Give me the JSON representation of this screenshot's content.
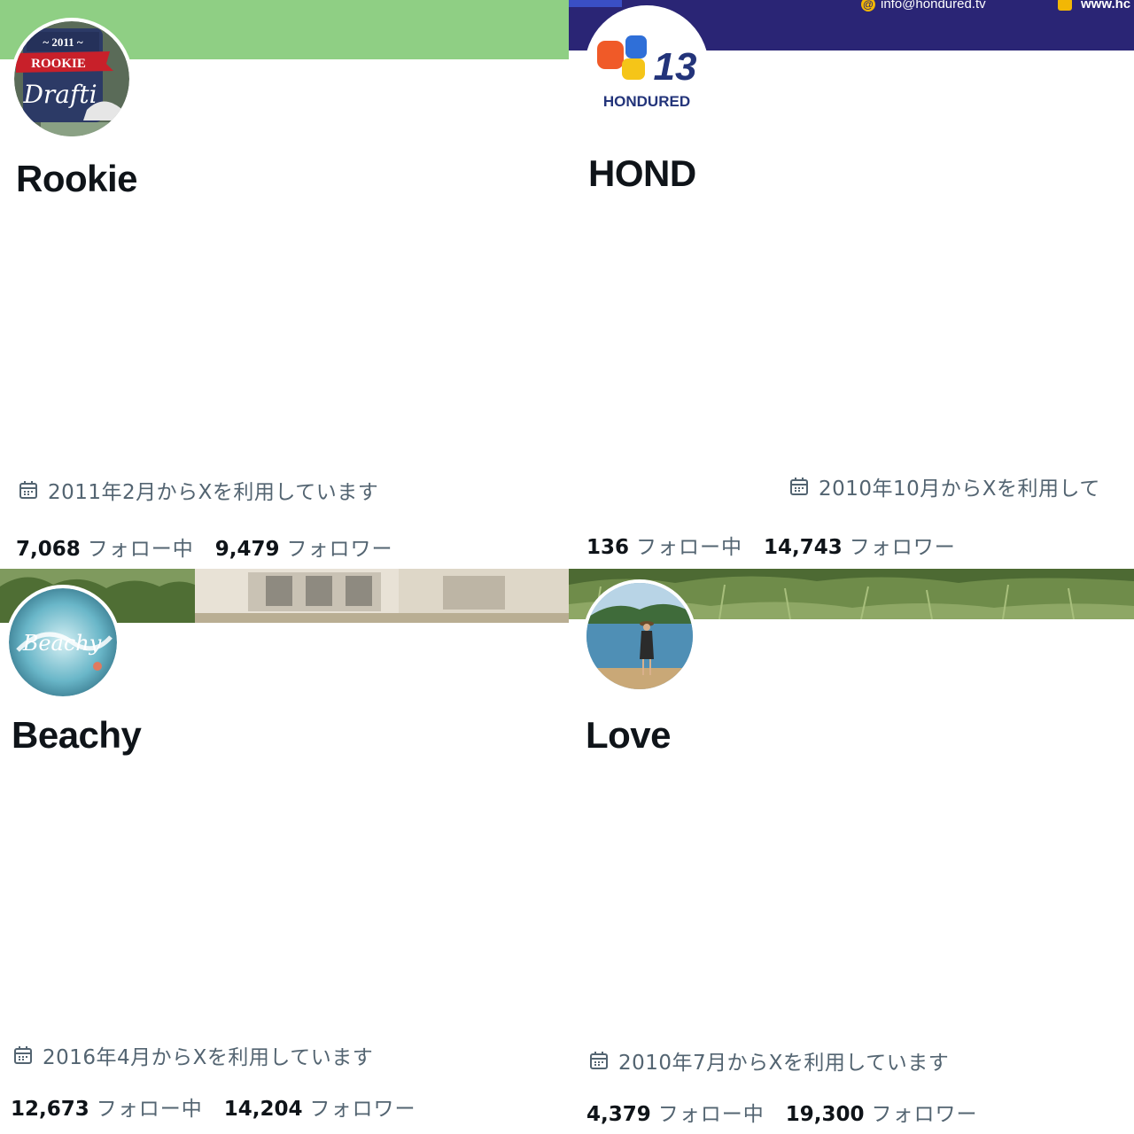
{
  "profiles": [
    {
      "name": "Rookie",
      "joined": "2011年2月からXを利用しています",
      "following": "7,068",
      "following_label": "フォロー中",
      "followers": "9,479",
      "followers_label": "フォロワー",
      "avatar_text": {
        "year": "~ 2011 ~",
        "ribbon": "ROOKIE",
        "script": "Drafti"
      },
      "banner_color": "#8fcf84"
    },
    {
      "name": "HOND",
      "joined": "2010年10月からXを利用して",
      "following": "136",
      "following_label": "フォロー中",
      "followers": "14,743",
      "followers_label": "フォロワー",
      "banner_email": "info@hondured.tv",
      "banner_web": "www.hc",
      "avatar_text": {
        "number": "13",
        "brand": "HONDURED"
      },
      "banner_color": "#2a2575"
    },
    {
      "name": "Beachy",
      "joined": "2016年4月からXを利用しています",
      "following": "12,673",
      "following_label": "フォロー中",
      "followers": "14,204",
      "followers_label": "フォロワー",
      "avatar_text": {
        "script": "Beachy"
      }
    },
    {
      "name": "Love",
      "joined": "2010年7月からXを利用しています",
      "following": "4,379",
      "following_label": "フォロー中",
      "followers": "19,300",
      "followers_label": "フォロワー"
    }
  ],
  "colors": {
    "text_primary": "#0f1419",
    "text_secondary": "#536471"
  },
  "icons": {
    "calendar": "calendar-icon",
    "email": "at-sign-icon",
    "web": "bus-icon"
  }
}
